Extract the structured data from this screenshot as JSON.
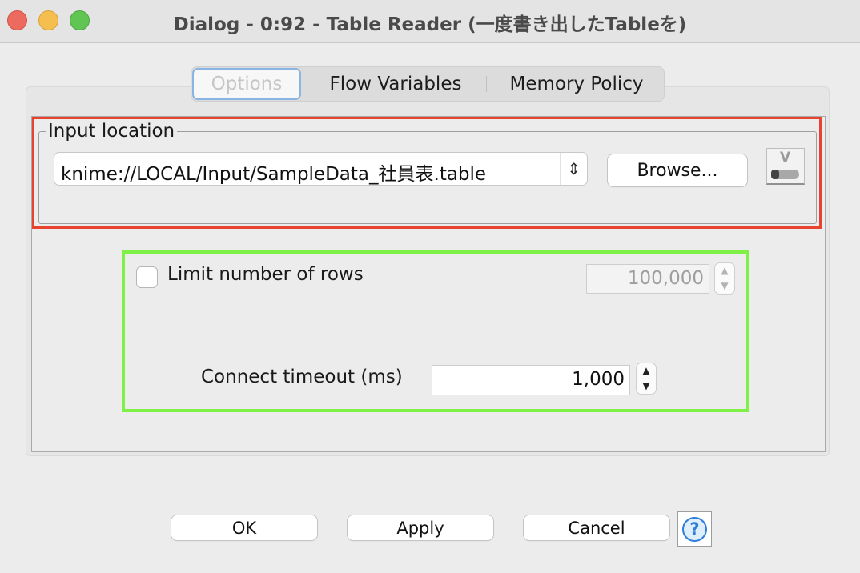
{
  "window": {
    "title": "Dialog - 0:92 - Table Reader (一度書き出したTableを)"
  },
  "tabs": [
    {
      "label": "Options",
      "selected": true
    },
    {
      "label": "Flow Variables",
      "selected": false
    },
    {
      "label": "Memory Policy",
      "selected": false
    }
  ],
  "input_location": {
    "legend": "Input location",
    "path_value": "knime://LOCAL/Input/SampleData_社員表.table",
    "browse_label": "Browse...",
    "flow_variable_icon": "flow-variable-toggle-icon"
  },
  "settings": {
    "limit_rows_label": "Limit number of rows",
    "limit_rows_checked": false,
    "limit_rows_value": "100,000",
    "timeout_label": "Connect timeout (ms)",
    "timeout_value": "1,000"
  },
  "footer": {
    "ok_label": "OK",
    "apply_label": "Apply",
    "cancel_label": "Cancel",
    "help_glyph": "?"
  },
  "colors": {
    "highlight_red": "#e8432f",
    "highlight_green": "#7ef046",
    "selected_tab_border": "#8ab4e2",
    "help_blue": "#2f7fd8"
  }
}
